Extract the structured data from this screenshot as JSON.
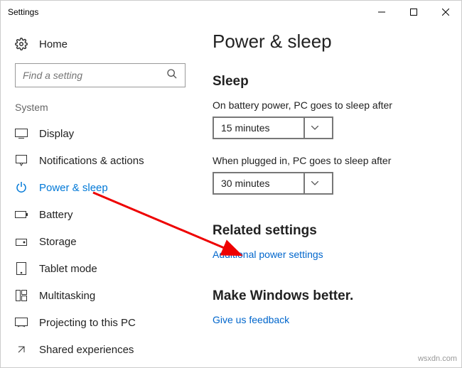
{
  "window": {
    "title": "Settings"
  },
  "header": {
    "home_label": "Home",
    "search_placeholder": "Find a setting"
  },
  "sidebar": {
    "group_label": "System",
    "items": [
      {
        "label": "Display"
      },
      {
        "label": "Notifications & actions"
      },
      {
        "label": "Power & sleep"
      },
      {
        "label": "Battery"
      },
      {
        "label": "Storage"
      },
      {
        "label": "Tablet mode"
      },
      {
        "label": "Multitasking"
      },
      {
        "label": "Projecting to this PC"
      },
      {
        "label": "Shared experiences"
      }
    ]
  },
  "main": {
    "title": "Power & sleep",
    "sleep": {
      "heading": "Sleep",
      "battery_label": "On battery power, PC goes to sleep after",
      "battery_value": "15 minutes",
      "plugged_label": "When plugged in, PC goes to sleep after",
      "plugged_value": "30 minutes"
    },
    "related": {
      "heading": "Related settings",
      "link": "Additional power settings"
    },
    "feedback": {
      "heading": "Make Windows better.",
      "link": "Give us feedback"
    }
  },
  "watermark": "wsxdn.com"
}
